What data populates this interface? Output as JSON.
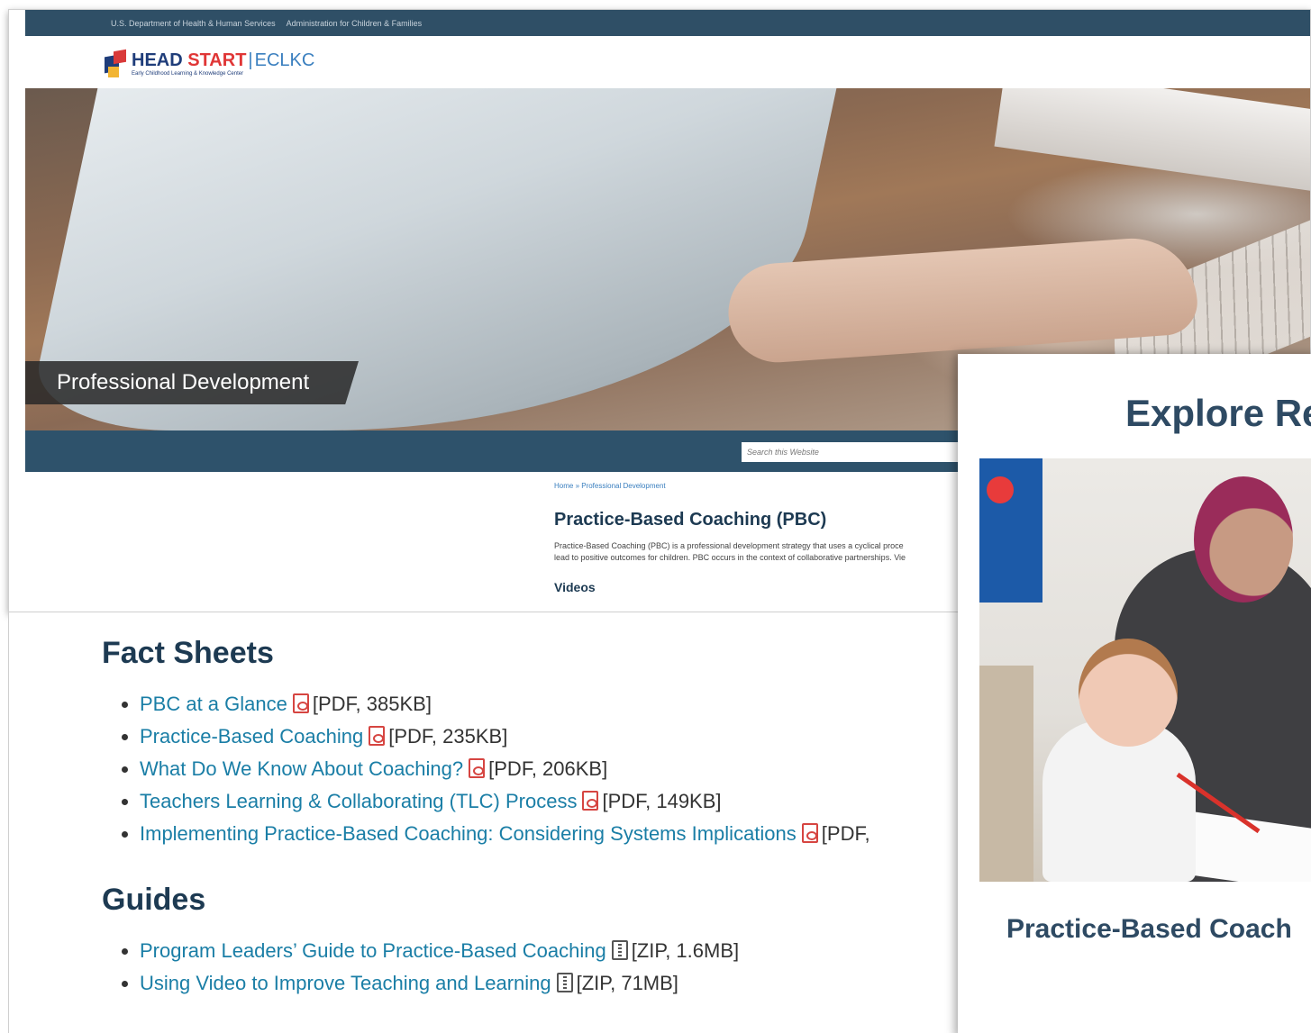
{
  "gov_bar": {
    "agency": "U.S. Department of Health & Human Services",
    "office": "Administration for Children & Families"
  },
  "logo": {
    "head": "HEAD",
    "start": "START",
    "separator": "|",
    "eclkc": "ECLKC",
    "subtitle": "Early Childhood Learning & Knowledge Center"
  },
  "hero": {
    "label": "Professional Development"
  },
  "search": {
    "placeholder": "Search this Website"
  },
  "breadcrumb": "Home » Professional Development",
  "page": {
    "title": "Practice-Based Coaching (PBC)",
    "intro_line1": "Practice-Based Coaching (PBC) is a professional development strategy that uses a cyclical proce",
    "intro_line2": "lead to positive outcomes for children. PBC occurs in the context of collaborative partnerships. Vie",
    "videos_heading": "Videos"
  },
  "fact_sheets": {
    "heading": "Fact Sheets",
    "items": [
      {
        "title": "PBC at a Glance",
        "meta": "[PDF, 385KB]"
      },
      {
        "title": "Practice-Based Coaching",
        "meta": "[PDF, 235KB]"
      },
      {
        "title": "What Do We Know About Coaching?",
        "meta": "[PDF, 206KB]"
      },
      {
        "title": "Teachers Learning & Collaborating (TLC) Process",
        "meta": "[PDF, 149KB]"
      },
      {
        "title": "Implementing Practice-Based Coaching: Considering Systems Implications",
        "meta": "[PDF,"
      }
    ]
  },
  "guides": {
    "heading": "Guides",
    "items": [
      {
        "title": "Program Leaders’ Guide to Practice-Based Coaching",
        "meta": "[ZIP, 1.6MB]"
      },
      {
        "title": "Using Video to Improve Teaching and Learning",
        "meta": "[ZIP, 71MB]"
      }
    ]
  },
  "explore": {
    "title": "Explore Re",
    "caption": "Practice-Based Coach"
  },
  "icons": {
    "pdf": "pdf-file-icon",
    "zip": "zip-file-icon"
  }
}
